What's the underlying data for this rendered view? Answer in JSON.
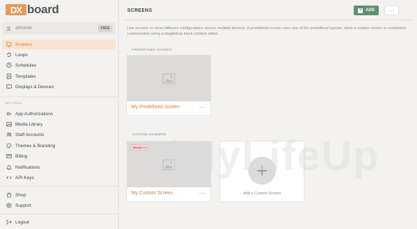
{
  "brand": {
    "logo_box": "DX",
    "logo_text": "board",
    "accent": "#e59a57"
  },
  "user": {
    "name": "abhishek",
    "badge": "FREE"
  },
  "nav": {
    "main": [
      {
        "label": "Screens",
        "icon": "screen-icon",
        "active": true
      },
      {
        "label": "Loops",
        "icon": "loop-icon"
      },
      {
        "label": "Schedules",
        "icon": "clock-icon"
      },
      {
        "label": "Templates",
        "icon": "template-icon"
      },
      {
        "label": "Displays & Devices",
        "icon": "display-icon"
      }
    ],
    "settings_heading": "SETTINGS",
    "settings": [
      {
        "label": "App Authorizations",
        "icon": "key-icon"
      },
      {
        "label": "Media Library",
        "icon": "media-icon"
      },
      {
        "label": "Staff Accounts",
        "icon": "staff-icon"
      },
      {
        "label": "Themes & Branding",
        "icon": "palette-icon"
      },
      {
        "label": "Billing",
        "icon": "billing-icon"
      },
      {
        "label": "Notifications",
        "icon": "bell-icon"
      },
      {
        "label": "API Keys",
        "icon": "code-icon"
      }
    ],
    "bottom": [
      {
        "label": "Shop",
        "icon": "shop-icon"
      },
      {
        "label": "Support",
        "icon": "support-icon"
      }
    ],
    "logout": {
      "label": "Logout",
      "icon": "logout-icon"
    }
  },
  "header": {
    "title": "SCREENS",
    "add_label": "ADD",
    "more_label": "···"
  },
  "intro": "Use screens to show different configurations across multiple devices. A predefined screen uses one of the predefined layouts, while a custom screen is completely customizable using a drag&drop block content editor.",
  "predefined": {
    "heading": "PREDEFINED SCREEN",
    "cards": [
      {
        "name": "My Predefined Screen"
      }
    ]
  },
  "custom": {
    "heading": "CUSTOM SCREENS",
    "cards": [
      {
        "name": "My Custom Screen",
        "badge": "DISABLED"
      }
    ],
    "add_label": "Add a Custom Screen"
  },
  "watermark": "PiMyLifeUp",
  "colors": {
    "primary_button": "#5f8f72",
    "active_nav_bg": "#f9e4d1",
    "active_nav_text": "#d7792f",
    "card_title": "#c9803c"
  }
}
